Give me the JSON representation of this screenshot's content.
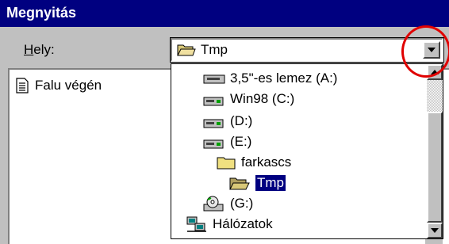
{
  "window": {
    "title": "Megnyitás"
  },
  "location": {
    "label_prefix": "H",
    "label_rest": "ely:",
    "current": "Tmp",
    "icon": "open-folder-icon"
  },
  "files": [
    {
      "name": "Falu végén",
      "icon": "text-document-icon"
    }
  ],
  "dropdown": {
    "items": [
      {
        "label": "3,5\"-es lemez (A:)",
        "icon": "floppy-drive-icon"
      },
      {
        "label": "Win98 (C:)",
        "icon": "hard-drive-icon"
      },
      {
        "label": "(D:)",
        "icon": "hard-drive-icon"
      },
      {
        "label": "(E:)",
        "icon": "hard-drive-icon"
      },
      {
        "label": "farkascs",
        "icon": "folder-icon"
      },
      {
        "label": "Tmp",
        "icon": "open-folder-icon",
        "selected": true
      },
      {
        "label": "(G:)",
        "icon": "cd-drive-icon"
      },
      {
        "label": "Hálózatok",
        "icon": "network-icon"
      }
    ]
  },
  "colors": {
    "titlebar": "#000080",
    "selection": "#000080",
    "dialog_bg": "#c0c0c0",
    "highlight_circle": "#e00000"
  }
}
